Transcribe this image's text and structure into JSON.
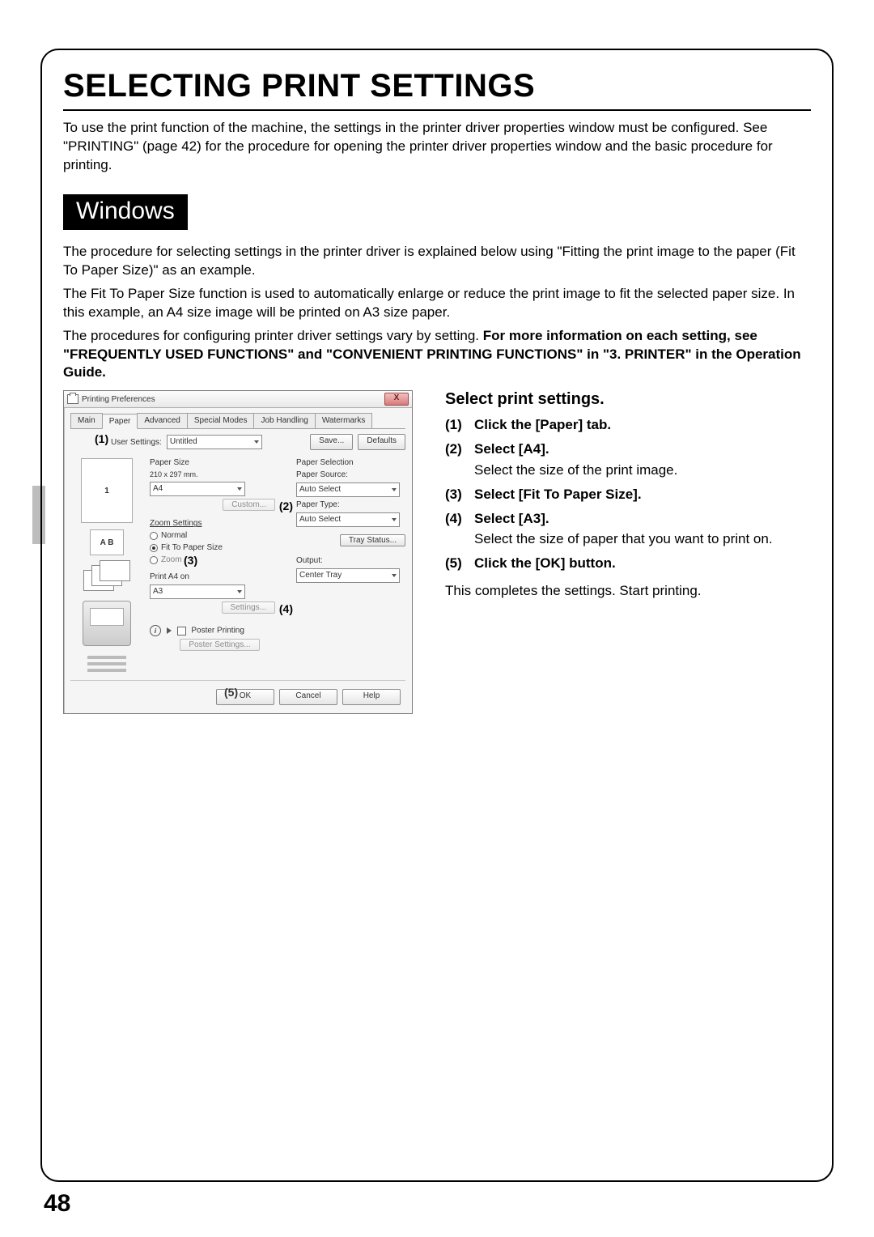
{
  "page": {
    "title": "SELECTING PRINT SETTINGS",
    "intro": "To use the print function of the machine, the settings in the printer driver properties window must be configured. See \"PRINTING\" (page 42) for the procedure for opening the printer driver properties window and the basic procedure for printing.",
    "number": "48"
  },
  "section": {
    "heading": "Windows",
    "para1": "The procedure for selecting settings in the printer driver is explained below using \"Fitting the print image to the paper (Fit To Paper Size)\" as an example.",
    "para2": "The Fit To Paper Size function is used to automatically enlarge or reduce the print image to fit the selected paper size. In this example, an A4 size image will be printed on A3 size paper.",
    "para3_plain": "The procedures for configuring printer driver settings vary by setting. ",
    "para3_bold": "For more information on each setting, see \"FREQUENTLY USED FUNCTIONS\" and \"CONVENIENT PRINTING FUNCTIONS\" in \"3. PRINTER\" in the Operation Guide."
  },
  "dialog": {
    "title": "Printing Preferences",
    "close": "X",
    "tabs": [
      "Main",
      "Paper",
      "Advanced",
      "Special Modes",
      "Job Handling",
      "Watermarks"
    ],
    "active_tab_index": 1,
    "user_settings_label": "User Settings:",
    "user_settings_value": "Untitled",
    "save_btn": "Save...",
    "defaults_btn": "Defaults",
    "paper_size_label": "Paper Size",
    "paper_size_dim": "210 x 297 mm.",
    "paper_size_value": "A4",
    "custom_btn": "Custom...",
    "zoom_label": "Zoom Settings",
    "zoom_normal": "Normal",
    "zoom_fit": "Fit To Paper Size",
    "zoom_zoom": "Zoom",
    "print_on_label": "Print A4 on",
    "print_on_value": "A3",
    "settings_btn": "Settings...",
    "poster_label": "Poster Printing",
    "poster_btn": "Poster Settings...",
    "paper_selection_label": "Paper Selection",
    "paper_source_label": "Paper Source:",
    "paper_source_value": "Auto Select",
    "paper_type_label": "Paper Type:",
    "paper_type_value": "Auto Select",
    "tray_status_btn": "Tray Status...",
    "output_label": "Output:",
    "output_value": "Center Tray",
    "ok_btn": "OK",
    "cancel_btn": "Cancel",
    "help_btn": "Help",
    "callouts": {
      "c1": "(1)",
      "c2": "(2)",
      "c3": "(3)",
      "c4": "(4)",
      "c5": "(5)"
    },
    "preview_page_number": "1",
    "preview_ab": "A  B"
  },
  "instructions": {
    "heading": "Select print settings.",
    "steps": [
      {
        "num": "(1)",
        "title": "Click the [Paper] tab.",
        "desc": ""
      },
      {
        "num": "(2)",
        "title": "Select [A4].",
        "desc": "Select the size of the print image."
      },
      {
        "num": "(3)",
        "title": "Select [Fit To Paper Size].",
        "desc": ""
      },
      {
        "num": "(4)",
        "title": "Select [A3].",
        "desc": "Select the size of paper that you want to print on."
      },
      {
        "num": "(5)",
        "title": "Click the [OK] button.",
        "desc": ""
      }
    ],
    "closing": "This completes the settings. Start printing."
  }
}
